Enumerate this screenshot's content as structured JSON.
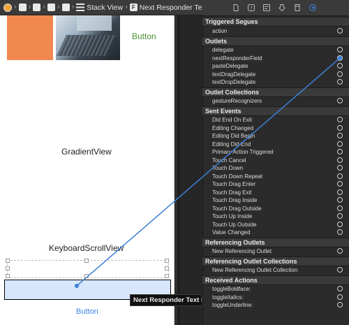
{
  "breadcrumb": {
    "stack_view": "Stack View",
    "field": "Next Responder Text Field"
  },
  "canvas": {
    "top_button": "Button",
    "gradient_view": "GradientView",
    "keyboard_scroll_view": "KeyboardScrollView",
    "bottom_button": "Button",
    "tooltip": "Next Responder Text Field"
  },
  "inspector": {
    "tabs": [
      "file-icon",
      "help-icon",
      "identity-icon",
      "attributes-icon",
      "size-icon",
      "connections-icon"
    ],
    "sections": {
      "triggered_segues": {
        "title": "Triggered Segues",
        "rows": [
          "action"
        ]
      },
      "outlets": {
        "title": "Outlets",
        "rows": [
          "delegate",
          "nextResponderField",
          "pasteDelegate",
          "textDragDelegate",
          "textDropDelegate"
        ]
      },
      "outlet_collections": {
        "title": "Outlet Collections",
        "rows": [
          "gestureRecognizers"
        ]
      },
      "sent_events": {
        "title": "Sent Events",
        "rows": [
          "Did End On Exit",
          "Editing Changed",
          "Editing Did Begin",
          "Editing Did End",
          "Primary Action Triggered",
          "Touch Cancel",
          "Touch Down",
          "Touch Down Repeat",
          "Touch Drag Enter",
          "Touch Drag Exit",
          "Touch Drag Inside",
          "Touch Drag Outside",
          "Touch Up Inside",
          "Touch Up Outside",
          "Value Changed"
        ]
      },
      "referencing_outlets": {
        "title": "Referencing Outlets",
        "rows": [
          "New Referencing Outlet"
        ]
      },
      "referencing_outlet_collections": {
        "title": "Referencing Outlet Collections",
        "rows": [
          "New Referencing Outlet Collection"
        ]
      },
      "received_actions": {
        "title": "Received Actions",
        "rows": [
          "toggleBoldface:",
          "toggleItalics:",
          "toggleUnderline:"
        ]
      }
    },
    "connected_outlet": "nextResponderField"
  },
  "colors": {
    "accent": "#3b86e6",
    "connection_line": "#3d7fd6",
    "orange": "#f0884f",
    "field_fill": "#d7e6fb"
  }
}
